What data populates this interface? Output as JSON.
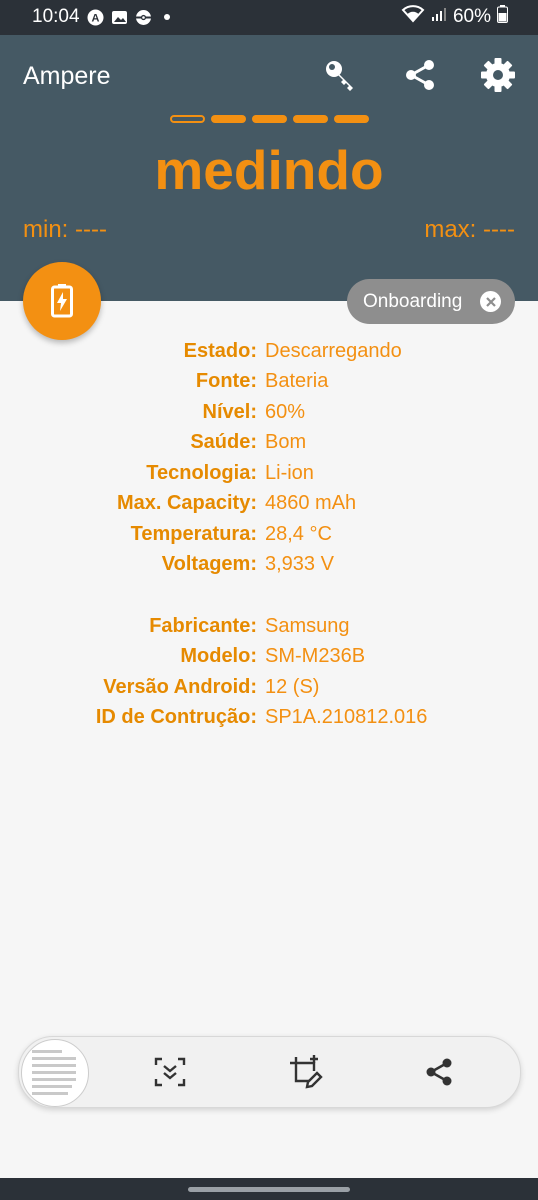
{
  "status_bar": {
    "time": "10:04",
    "battery_percent": "60%",
    "icons": [
      "vpn-a-icon",
      "gallery-icon",
      "pokeball-icon",
      "dot-icon",
      "wifi-icon",
      "signal-icon",
      "battery-icon"
    ]
  },
  "header": {
    "app_title": "Ampere",
    "state": "medindo",
    "min_label": "min: ----",
    "max_label": "max: ----",
    "icons": [
      "key-icon",
      "share-icon",
      "settings-icon"
    ],
    "accent_color": "#f39012",
    "bg_color": "#455964"
  },
  "chip": {
    "label": "Onboarding"
  },
  "battery_info": [
    {
      "label": "Estado:",
      "value": "Descarregando"
    },
    {
      "label": "Fonte:",
      "value": "Bateria"
    },
    {
      "label": "Nível:",
      "value": "60%"
    },
    {
      "label": "Saúde:",
      "value": "Bom"
    },
    {
      "label": "Tecnologia:",
      "value": "Li-ion"
    },
    {
      "label": "Max. Capacity:",
      "value": "4860 mAh"
    },
    {
      "label": "Temperatura:",
      "value": "28,4 °C"
    },
    {
      "label": "Voltagem:",
      "value": "3,933 V"
    }
  ],
  "device_info": [
    {
      "label": "Fabricante:",
      "value": "Samsung"
    },
    {
      "label": "Modelo:",
      "value": "SM-M236B"
    },
    {
      "label": "Versão Android:",
      "value": "12 (S)"
    },
    {
      "label": "ID de Contrução:",
      "value": "SP1A.210812.016"
    }
  ],
  "screenshot_toolbar": {
    "icons": [
      "scroll-capture-icon",
      "crop-edit-icon",
      "share-icon"
    ]
  }
}
